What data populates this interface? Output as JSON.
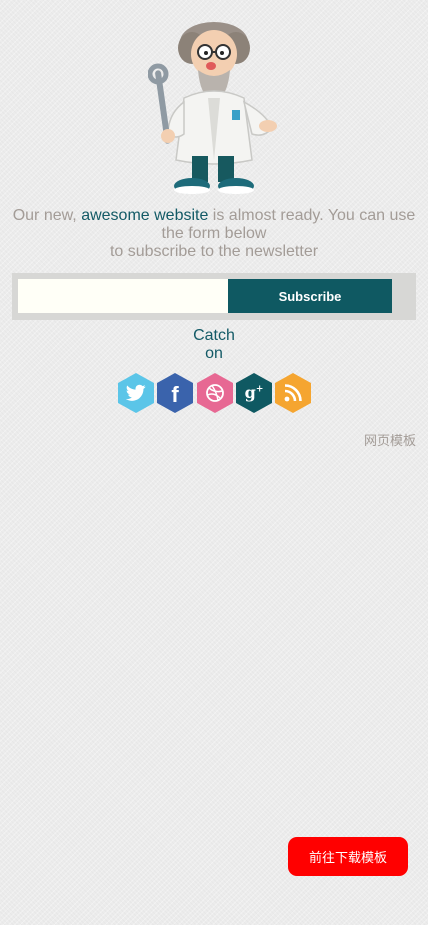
{
  "intro": {
    "text_before": "Our new, ",
    "highlight": "awesome website",
    "text_after": " is almost ready. You can use the form below",
    "line2": "to subscribe to the newsletter"
  },
  "subscribe_form": {
    "email_value": "",
    "email_placeholder": "",
    "button_label": "Subscribe"
  },
  "catch_on": {
    "line1": "Catch",
    "line2": "on"
  },
  "social_icons": [
    "twitter-icon",
    "facebook-icon",
    "dribbble-icon",
    "google-plus-icon",
    "rss-icon"
  ],
  "links": {
    "template": "网页模板"
  },
  "download_button": {
    "label": "前往下载模板"
  },
  "colors": {
    "accent": "#0f5962",
    "body_text": "#a39c97",
    "download": "#ff0000",
    "twitter": "#5bc5e8",
    "facebook": "#3a63ac",
    "dribbble": "#e76893",
    "google_plus": "#0f5962",
    "rss": "#f5a530"
  }
}
